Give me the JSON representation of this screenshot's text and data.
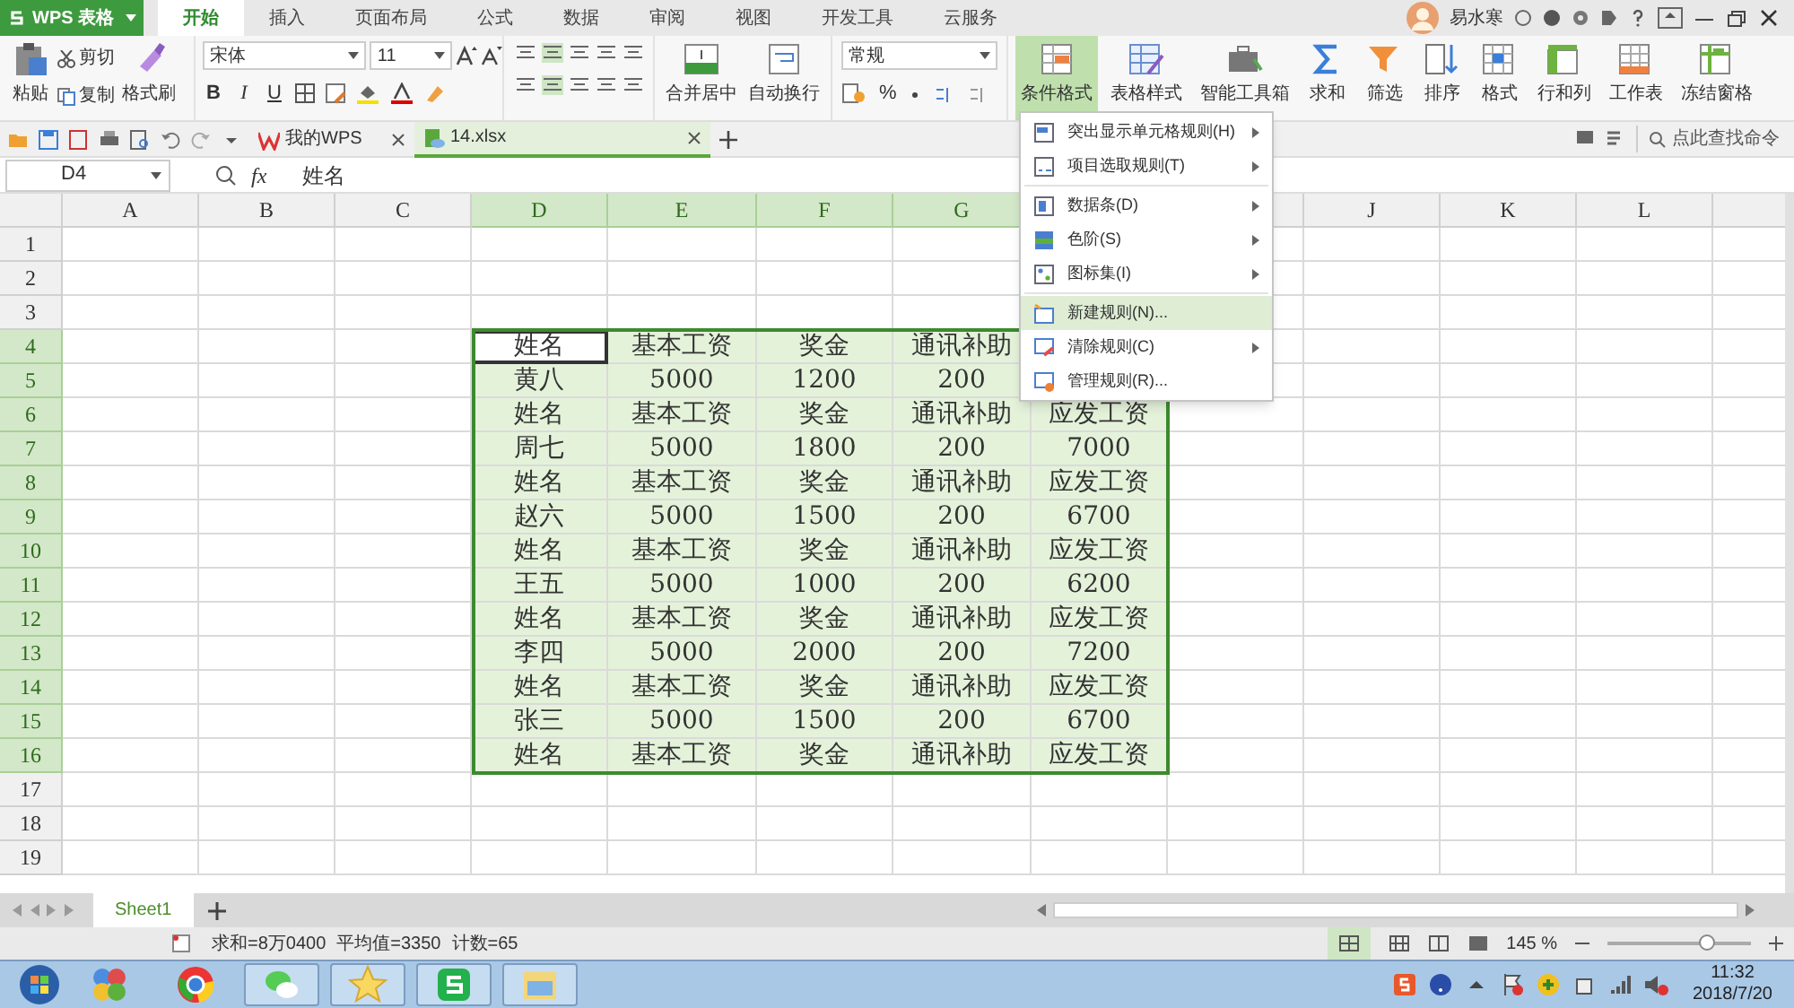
{
  "app_button": {
    "label": "WPS 表格"
  },
  "ribbon_tabs": [
    {
      "label": "开始",
      "selected": true
    },
    {
      "label": "插入",
      "selected": false
    },
    {
      "label": "页面布局",
      "selected": false
    },
    {
      "label": "公式",
      "selected": false
    },
    {
      "label": "数据",
      "selected": false
    },
    {
      "label": "审阅",
      "selected": false
    },
    {
      "label": "视图",
      "selected": false
    },
    {
      "label": "开发工具",
      "selected": false
    },
    {
      "label": "云服务",
      "selected": false
    }
  ],
  "user": {
    "name": "易水寒"
  },
  "ribbon": {
    "clipboard": {
      "paste": "粘贴",
      "cut": "剪切",
      "copy": "复制",
      "format_painter": "格式刷"
    },
    "font": {
      "name": "宋体",
      "size": "11",
      "style_buttons": [
        "B",
        "I",
        "U"
      ]
    },
    "alignment": {
      "merge": "合并居中",
      "wrap": "自动换行"
    },
    "number": {
      "format": "常规",
      "percent": "%"
    },
    "buttons": [
      {
        "label": "条件格式",
        "selected": true,
        "kind": "cond"
      },
      {
        "label": "表格样式",
        "selected": false,
        "kind": "style"
      },
      {
        "label": "智能工具箱",
        "selected": false,
        "kind": "toolbox"
      },
      {
        "label": "求和",
        "selected": false,
        "kind": "sum"
      },
      {
        "label": "筛选",
        "selected": false,
        "kind": "filter"
      },
      {
        "label": "排序",
        "selected": false,
        "kind": "sort"
      },
      {
        "label": "格式",
        "selected": false,
        "kind": "format"
      },
      {
        "label": "行和列",
        "selected": false,
        "kind": "rowcol"
      },
      {
        "label": "工作表",
        "selected": false,
        "kind": "sheet"
      },
      {
        "label": "冻结窗格",
        "selected": false,
        "kind": "freeze"
      }
    ]
  },
  "doc_tabs": [
    {
      "label": "我的WPS",
      "selected": false
    },
    {
      "label": "14.xlsx",
      "selected": true
    }
  ],
  "command_search": {
    "placeholder": "点此查找命令"
  },
  "formula_bar": {
    "cell": "D4",
    "fx": "fx",
    "value": "姓名"
  },
  "sheet": {
    "columns": [
      {
        "label": "A",
        "selected": false
      },
      {
        "label": "B",
        "selected": false
      },
      {
        "label": "C",
        "selected": false
      },
      {
        "label": "D",
        "selected": true
      },
      {
        "label": "E",
        "selected": true
      },
      {
        "label": "F",
        "selected": true
      },
      {
        "label": "G",
        "selected": true
      },
      {
        "label": "J",
        "selected": false
      },
      {
        "label": "K",
        "selected": false
      },
      {
        "label": "L",
        "selected": false
      }
    ],
    "rows": [
      {
        "label": "1",
        "selected": false
      },
      {
        "label": "2",
        "selected": false
      },
      {
        "label": "3",
        "selected": false
      },
      {
        "label": "4",
        "selected": true
      },
      {
        "label": "5",
        "selected": true
      },
      {
        "label": "6",
        "selected": true
      },
      {
        "label": "7",
        "selected": true
      },
      {
        "label": "8",
        "selected": true
      },
      {
        "label": "9",
        "selected": true
      },
      {
        "label": "10",
        "selected": true
      },
      {
        "label": "11",
        "selected": true
      },
      {
        "label": "12",
        "selected": true
      },
      {
        "label": "13",
        "selected": true
      },
      {
        "label": "14",
        "selected": true
      },
      {
        "label": "15",
        "selected": true
      },
      {
        "label": "16",
        "selected": true
      },
      {
        "label": "17",
        "selected": false
      },
      {
        "label": "18",
        "selected": false
      },
      {
        "label": "19",
        "selected": false
      }
    ],
    "table": [
      [
        {
          "text": "姓名",
          "selected": true
        },
        {
          "text": "基本工资",
          "selected": false
        },
        {
          "text": "奖金",
          "selected": false
        },
        {
          "text": "通讯补助",
          "selected": false
        }
      ],
      [
        {
          "text": "黄八",
          "selected": false
        },
        {
          "text": "5000",
          "selected": false
        },
        {
          "text": "1200",
          "selected": false
        },
        {
          "text": "200",
          "selected": false
        }
      ],
      [
        {
          "text": "姓名",
          "selected": false
        },
        {
          "text": "基本工资",
          "selected": false
        },
        {
          "text": "奖金",
          "selected": false
        },
        {
          "text": "通讯补助",
          "selected": false
        },
        {
          "text": "应发工资",
          "selected": false
        }
      ],
      [
        {
          "text": "周七",
          "selected": false
        },
        {
          "text": "5000",
          "selected": false
        },
        {
          "text": "1800",
          "selected": false
        },
        {
          "text": "200",
          "selected": false
        },
        {
          "text": "7000",
          "selected": false
        }
      ],
      [
        {
          "text": "姓名",
          "selected": false
        },
        {
          "text": "基本工资",
          "selected": false
        },
        {
          "text": "奖金",
          "selected": false
        },
        {
          "text": "通讯补助",
          "selected": false
        },
        {
          "text": "应发工资",
          "selected": false
        }
      ],
      [
        {
          "text": "赵六",
          "selected": false
        },
        {
          "text": "5000",
          "selected": false
        },
        {
          "text": "1500",
          "selected": false
        },
        {
          "text": "200",
          "selected": false
        },
        {
          "text": "6700",
          "selected": false
        }
      ],
      [
        {
          "text": "姓名",
          "selected": false
        },
        {
          "text": "基本工资",
          "selected": false
        },
        {
          "text": "奖金",
          "selected": false
        },
        {
          "text": "通讯补助",
          "selected": false
        },
        {
          "text": "应发工资",
          "selected": false
        }
      ],
      [
        {
          "text": "王五",
          "selected": false
        },
        {
          "text": "5000",
          "selected": false
        },
        {
          "text": "1000",
          "selected": false
        },
        {
          "text": "200",
          "selected": false
        },
        {
          "text": "6200",
          "selected": false
        }
      ],
      [
        {
          "text": "姓名",
          "selected": false
        },
        {
          "text": "基本工资",
          "selected": false
        },
        {
          "text": "奖金",
          "selected": false
        },
        {
          "text": "通讯补助",
          "selected": false
        },
        {
          "text": "应发工资",
          "selected": false
        }
      ],
      [
        {
          "text": "李四",
          "selected": false
        },
        {
          "text": "5000",
          "selected": false
        },
        {
          "text": "2000",
          "selected": false
        },
        {
          "text": "200",
          "selected": false
        },
        {
          "text": "7200",
          "selected": false
        }
      ],
      [
        {
          "text": "姓名",
          "selected": false
        },
        {
          "text": "基本工资",
          "selected": false
        },
        {
          "text": "奖金",
          "selected": false
        },
        {
          "text": "通讯补助",
          "selected": false
        },
        {
          "text": "应发工资",
          "selected": false
        }
      ],
      [
        {
          "text": "张三",
          "selected": false
        },
        {
          "text": "5000",
          "selected": false
        },
        {
          "text": "1500",
          "selected": false
        },
        {
          "text": "200",
          "selected": false
        },
        {
          "text": "6700",
          "selected": false
        }
      ],
      [
        {
          "text": "姓名",
          "selected": false
        },
        {
          "text": "基本工资",
          "selected": false
        },
        {
          "text": "奖金",
          "selected": false
        },
        {
          "text": "通讯补助",
          "selected": false
        },
        {
          "text": "应发工资",
          "selected": false
        }
      ]
    ]
  },
  "menu": [
    {
      "label": "突出显示单元格规则(H)",
      "submenu": true,
      "selected": false
    },
    {
      "label": "项目选取规则(T)",
      "submenu": true,
      "selected": false
    },
    {
      "kind": "separator"
    },
    {
      "label": "数据条(D)",
      "submenu": true,
      "selected": false
    },
    {
      "label": "色阶(S)",
      "submenu": true,
      "selected": false
    },
    {
      "label": "图标集(I)",
      "submenu": true,
      "selected": false
    },
    {
      "kind": "separator"
    },
    {
      "label": "新建规则(N)...",
      "submenu": false,
      "selected": true
    },
    {
      "label": "清除规则(C)",
      "submenu": true,
      "selected": false
    },
    {
      "label": "管理规则(R)...",
      "submenu": false,
      "selected": false
    }
  ],
  "sheet_tabs": [
    {
      "label": "Sheet1",
      "selected": true
    }
  ],
  "status_bar": {
    "sum": "求和=8万0400",
    "average": "平均值=3350",
    "count": "计数=65",
    "zoom": "145 %",
    "zoom_slider": {
      "level": 0.72
    }
  },
  "taskbar": {
    "time": "11:32",
    "date": "2018/7/20"
  }
}
